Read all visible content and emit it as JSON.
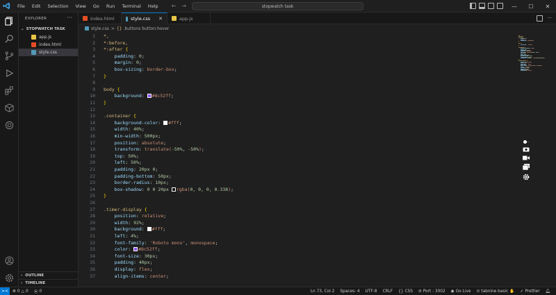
{
  "titlebar": {
    "menu": [
      "File",
      "Edit",
      "Selection",
      "View",
      "Go",
      "Run",
      "Terminal",
      "Help"
    ],
    "search_text": "stopwatch task"
  },
  "sidebar": {
    "header": "EXPLORER",
    "folder": "STOPWATCH TASK",
    "files": [
      {
        "name": "app.js",
        "color": "#e8c547"
      },
      {
        "name": "index.html",
        "color": "#e44d26"
      },
      {
        "name": "style.css",
        "color": "#519aba"
      }
    ],
    "sections": [
      "OUTLINE",
      "TIMELINE"
    ]
  },
  "tabs": [
    {
      "label": "index.html",
      "color": "#e44d26",
      "active": false
    },
    {
      "label": "style.css",
      "color": "#519aba",
      "active": true
    },
    {
      "label": "app.js",
      "color": "#e8c547",
      "active": false
    }
  ],
  "breadcrumb": {
    "file": "style.css",
    "sep": ">",
    "symbol": ".buttons button:hover"
  },
  "code_lines": [
    {
      "n": 1,
      "t": [
        [
          "sel",
          "*,"
        ]
      ]
    },
    {
      "n": 2,
      "t": [
        [
          "sel",
          "*:before,"
        ]
      ]
    },
    {
      "n": 3,
      "t": [
        [
          "sel",
          "*:after "
        ],
        [
          "brace",
          "{"
        ]
      ]
    },
    {
      "n": 4,
      "t": [
        [
          "ind",
          "    "
        ],
        [
          "prop",
          "padding"
        ],
        [
          "punc",
          ": "
        ],
        [
          "num",
          "0"
        ],
        [
          "punc",
          ";"
        ]
      ]
    },
    {
      "n": 5,
      "t": [
        [
          "ind",
          "    "
        ],
        [
          "prop",
          "margin"
        ],
        [
          "punc",
          ": "
        ],
        [
          "num",
          "0"
        ],
        [
          "punc",
          ";"
        ]
      ]
    },
    {
      "n": 6,
      "t": [
        [
          "ind",
          "    "
        ],
        [
          "prop",
          "box-sizing"
        ],
        [
          "punc",
          ": "
        ],
        [
          "val",
          "border-box"
        ],
        [
          "punc",
          ";"
        ]
      ]
    },
    {
      "n": 7,
      "t": [
        [
          "brace",
          "}"
        ]
      ]
    },
    {
      "n": 8,
      "t": []
    },
    {
      "n": 9,
      "t": [
        [
          "sel",
          "body "
        ],
        [
          "brace",
          "{"
        ]
      ]
    },
    {
      "n": 10,
      "t": [
        [
          "ind",
          "    "
        ],
        [
          "prop",
          "background"
        ],
        [
          "punc",
          ": "
        ],
        [
          "sw",
          "#8c52ff"
        ],
        [
          "val",
          "#8c52ff"
        ],
        [
          "punc",
          ";"
        ]
      ]
    },
    {
      "n": 11,
      "t": [
        [
          "brace",
          "}"
        ]
      ]
    },
    {
      "n": 12,
      "t": []
    },
    {
      "n": 13,
      "t": [
        [
          "sel",
          ".container "
        ],
        [
          "brace",
          "{"
        ]
      ]
    },
    {
      "n": 14,
      "t": [
        [
          "ind",
          "    "
        ],
        [
          "prop",
          "background-color"
        ],
        [
          "punc",
          ": "
        ],
        [
          "sw",
          "#ffffff"
        ],
        [
          "val",
          "#fff"
        ],
        [
          "punc",
          ";"
        ]
      ]
    },
    {
      "n": 15,
      "t": [
        [
          "ind",
          "    "
        ],
        [
          "prop",
          "width"
        ],
        [
          "punc",
          ": "
        ],
        [
          "num",
          "40%"
        ],
        [
          "punc",
          ";"
        ]
      ]
    },
    {
      "n": 16,
      "t": [
        [
          "ind",
          "    "
        ],
        [
          "prop",
          "min-width"
        ],
        [
          "punc",
          ": "
        ],
        [
          "num",
          "500px"
        ],
        [
          "punc",
          ";"
        ]
      ]
    },
    {
      "n": 17,
      "t": [
        [
          "ind",
          "    "
        ],
        [
          "prop",
          "position"
        ],
        [
          "punc",
          ": "
        ],
        [
          "val",
          "absolute"
        ],
        [
          "punc",
          ";"
        ]
      ]
    },
    {
      "n": 18,
      "t": [
        [
          "ind",
          "    "
        ],
        [
          "prop",
          "transform"
        ],
        [
          "punc",
          ": "
        ],
        [
          "val",
          "translate("
        ],
        [
          "num",
          "-50%"
        ],
        [
          "punc",
          ", "
        ],
        [
          "num",
          "-50%"
        ],
        [
          "val",
          ")"
        ],
        [
          "punc",
          ";"
        ]
      ]
    },
    {
      "n": 19,
      "t": [
        [
          "ind",
          "    "
        ],
        [
          "prop",
          "top"
        ],
        [
          "punc",
          ": "
        ],
        [
          "num",
          "50%"
        ],
        [
          "punc",
          ";"
        ]
      ]
    },
    {
      "n": 20,
      "t": [
        [
          "ind",
          "    "
        ],
        [
          "prop",
          "left"
        ],
        [
          "punc",
          ": "
        ],
        [
          "num",
          "50%"
        ],
        [
          "punc",
          ";"
        ]
      ]
    },
    {
      "n": 21,
      "t": [
        [
          "ind",
          "    "
        ],
        [
          "prop",
          "padding"
        ],
        [
          "punc",
          ": "
        ],
        [
          "num",
          "20px 0"
        ],
        [
          "punc",
          ";"
        ]
      ]
    },
    {
      "n": 22,
      "t": [
        [
          "ind",
          "    "
        ],
        [
          "prop",
          "padding-bottom"
        ],
        [
          "punc",
          ": "
        ],
        [
          "num",
          "50px"
        ],
        [
          "punc",
          ";"
        ]
      ]
    },
    {
      "n": 23,
      "t": [
        [
          "ind",
          "    "
        ],
        [
          "prop",
          "border-radius"
        ],
        [
          "punc",
          ": "
        ],
        [
          "num",
          "10px"
        ],
        [
          "punc",
          ";"
        ]
      ]
    },
    {
      "n": 24,
      "t": [
        [
          "ind",
          "    "
        ],
        [
          "prop",
          "box-shadow"
        ],
        [
          "punc",
          ": "
        ],
        [
          "num",
          "0 0 20px "
        ],
        [
          "sw",
          "rgba(0,0,0,0.338)"
        ],
        [
          "val",
          "rgba("
        ],
        [
          "num",
          "0, 0, 0, 0.338"
        ],
        [
          "val",
          ")"
        ],
        [
          "punc",
          ";"
        ]
      ]
    },
    {
      "n": 25,
      "t": [
        [
          "brace",
          "}"
        ]
      ]
    },
    {
      "n": 26,
      "t": []
    },
    {
      "n": 27,
      "t": [
        [
          "sel",
          ".timer-display "
        ],
        [
          "brace",
          "{"
        ]
      ]
    },
    {
      "n": 28,
      "t": [
        [
          "ind",
          "    "
        ],
        [
          "prop",
          "position"
        ],
        [
          "punc",
          ": "
        ],
        [
          "val",
          "relative"
        ],
        [
          "punc",
          ";"
        ]
      ]
    },
    {
      "n": 29,
      "t": [
        [
          "ind",
          "    "
        ],
        [
          "prop",
          "width"
        ],
        [
          "punc",
          ": "
        ],
        [
          "num",
          "92%"
        ],
        [
          "punc",
          ";"
        ]
      ]
    },
    {
      "n": 30,
      "t": [
        [
          "ind",
          "    "
        ],
        [
          "prop",
          "background"
        ],
        [
          "punc",
          ": "
        ],
        [
          "sw",
          "#ffffff"
        ],
        [
          "val",
          "#fff"
        ],
        [
          "punc",
          ";"
        ]
      ]
    },
    {
      "n": 31,
      "t": [
        [
          "ind",
          "    "
        ],
        [
          "prop",
          "left"
        ],
        [
          "punc",
          ": "
        ],
        [
          "num",
          "4%"
        ],
        [
          "punc",
          ";"
        ]
      ]
    },
    {
      "n": 32,
      "t": [
        [
          "ind",
          "    "
        ],
        [
          "prop",
          "font-family"
        ],
        [
          "punc",
          ": "
        ],
        [
          "str",
          "'Roboto mono'"
        ],
        [
          "punc",
          ", "
        ],
        [
          "val",
          "monospace"
        ],
        [
          "punc",
          ";"
        ]
      ]
    },
    {
      "n": 33,
      "t": [
        [
          "ind",
          "    "
        ],
        [
          "prop",
          "color"
        ],
        [
          "punc",
          ": "
        ],
        [
          "sw",
          "#8c52ff"
        ],
        [
          "val",
          "#8c52ff"
        ],
        [
          "punc",
          ";"
        ]
      ]
    },
    {
      "n": 34,
      "t": [
        [
          "ind",
          "    "
        ],
        [
          "prop",
          "font-size"
        ],
        [
          "punc",
          ": "
        ],
        [
          "num",
          "30px"
        ],
        [
          "punc",
          ";"
        ]
      ]
    },
    {
      "n": 35,
      "t": [
        [
          "ind",
          "    "
        ],
        [
          "prop",
          "padding"
        ],
        [
          "punc",
          ": "
        ],
        [
          "num",
          "40px"
        ],
        [
          "punc",
          ";"
        ]
      ]
    },
    {
      "n": 36,
      "t": [
        [
          "ind",
          "    "
        ],
        [
          "prop",
          "display"
        ],
        [
          "punc",
          ": "
        ],
        [
          "val",
          "flex"
        ],
        [
          "punc",
          ";"
        ]
      ]
    },
    {
      "n": 37,
      "t": [
        [
          "ind",
          "    "
        ],
        [
          "prop",
          "align-items"
        ],
        [
          "punc",
          ": "
        ],
        [
          "val",
          "center"
        ],
        [
          "punc",
          ";"
        ]
      ]
    }
  ],
  "statusbar": {
    "errors": "0",
    "warnings": "0",
    "ports": "0",
    "position": "Ln 73, Col 2",
    "spaces": "Spaces: 4",
    "encoding": "UTF-8",
    "eol": "CRLF",
    "language": "CSS",
    "port": "Port : 3002",
    "golive": "Go Live",
    "tabnine": "tabnine basic",
    "prettier": "Prettier"
  },
  "colors": {
    "accent": "#0078d4",
    "editor_bg": "#1f1f1f",
    "sidebar_bg": "#181818"
  }
}
